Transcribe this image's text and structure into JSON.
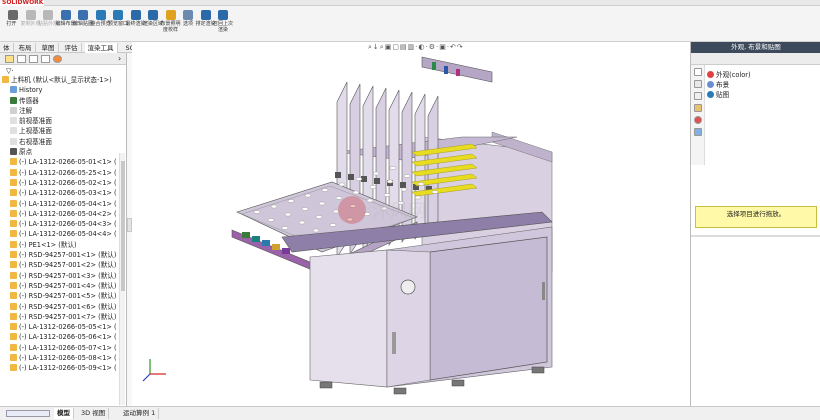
{
  "app": {
    "logo": "SOLIDWORKS"
  },
  "ribbon": [
    {
      "label": "打开  ",
      "icon": "plus-icon",
      "disabled": false
    },
    {
      "label": "复制外观",
      "icon": "copy-appearance-icon",
      "disabled": true
    },
    {
      "label": "粘贴外观",
      "icon": "paste-appearance-icon",
      "disabled": true
    },
    {
      "label": "编辑布景",
      "icon": "edit-scene-icon",
      "disabled": false
    },
    {
      "label": "编辑贴图",
      "icon": "edit-decal-icon",
      "disabled": false
    },
    {
      "label": "整合预览",
      "icon": "integrated-preview-icon",
      "disabled": false
    },
    {
      "label": "预览窗口",
      "icon": "preview-window-icon",
      "disabled": false
    },
    {
      "label": "最终渲染",
      "icon": "final-render-icon",
      "disabled": false
    },
    {
      "label": "渲染区域",
      "icon": "render-region-icon",
      "disabled": false
    },
    {
      "label": "布景照明度校样",
      "icon": "lighting-proof-icon",
      "disabled": false
    },
    {
      "label": "选项",
      "icon": "options-icon",
      "disabled": false
    },
    {
      "label": "排定渲染",
      "icon": "schedule-render-icon",
      "disabled": false
    },
    {
      "label": "召回上次渲染",
      "icon": "recall-render-icon",
      "disabled": false
    }
  ],
  "tabs": [
    "体",
    "布局",
    "草图",
    "评估",
    "渲染工具",
    "SOLIDWORKS 插件",
    "SOLIDWORKS MBD"
  ],
  "active_tab": "渲染工具",
  "tree": {
    "filter": "▽·",
    "root": "上料机 (默认<默认_显示状态-1>)",
    "items": [
      "History",
      "传感器",
      "注解",
      "前视基准面",
      "上视基准面",
      "右视基准面",
      "原点",
      "(-) LA-1312-0266-05-01<1> (",
      "(-) LA-1312-0266-05-25<1> (",
      "(-) LA-1312-0266-05-02<1> (",
      "(-) LA-1312-0266-05-03<1> (",
      "(-) LA-1312-0266-05-04<1> (",
      "(-) LA-1312-0266-05-04<2> (",
      "(-) LA-1312-0266-05-04<3> (",
      "(-) LA-1312-0266-05-04<4> (",
      "(-) PE1<1> (默认)",
      "(-) RSD-94257-001<1> (默认)",
      "(-) RSD-94257-001<2> (默认)",
      "(-) RSD-94257-001<3> (默认)",
      "(-) RSD-94257-001<4> (默认)",
      "(-) RSD-94257-001<5> (默认)",
      "(-) RSD-94257-001<6> (默认)",
      "(-) RSD-94257-001<7> (默认)",
      "(-) LA-1312-0266-05-05<1> (",
      "(-) LA-1312-0266-05-06<1> (",
      "(-) LA-1312-0266-05-07<1> (",
      "(-) LA-1312-0266-05-08<1> (",
      "(-) LA-1312-0266-05-09<1> ("
    ]
  },
  "right_panel": {
    "title": "外观, 布景和贴图",
    "items": [
      "外观(color)",
      "布景",
      "贴图"
    ],
    "message": "选择项目进行拖放。"
  },
  "viewtool": "⌕↓⌕▣▢▤▥·◐·⚙·▣·↶↷",
  "bottom": {
    "tabs": [
      "模型",
      "3D 视图",
      "运动算例 1"
    ],
    "active": "模型"
  },
  "colors": {
    "machine": "#c9bdd6",
    "machine_dark": "#8f7fa3",
    "yellow": "#e8dc20",
    "accent": "#d42020"
  }
}
